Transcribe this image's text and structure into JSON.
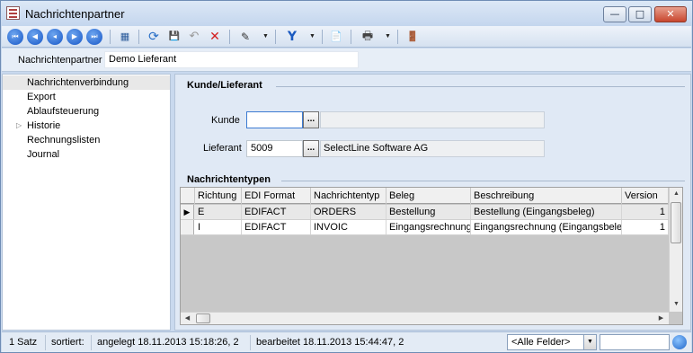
{
  "window": {
    "title": "Nachrichtenpartner"
  },
  "window_controls": {
    "minimize": "—",
    "maximize": "□",
    "close": "✕"
  },
  "toolbar": {
    "icons": [
      "first-record-icon",
      "prev-page-icon",
      "prev-record-icon",
      "next-record-icon",
      "last-record-icon",
      "table-view-icon",
      "refresh-icon",
      "save-icon",
      "undo-icon",
      "delete-icon",
      "tools-icon",
      "filter-icon",
      "document-icon",
      "print-icon",
      "exit-icon"
    ],
    "glyphs": {
      "first": "⏮",
      "prev_page": "◀",
      "prev": "◂",
      "next": "▶",
      "last": "⏭",
      "table": "▦",
      "refresh": "⟳",
      "save": "💾",
      "undo": "↶",
      "delete": "✕",
      "tools": "✎",
      "filter": "Y",
      "document": "📄",
      "print": "🖶",
      "exit": "🚪",
      "dropdown": "▼"
    }
  },
  "partner": {
    "label": "Nachrichtenpartner",
    "value": "Demo Lieferant"
  },
  "sidebar": {
    "items": [
      {
        "label": "Nachrichtenverbindung",
        "active": true,
        "expandable": false
      },
      {
        "label": "Export",
        "active": false,
        "expandable": false
      },
      {
        "label": "Ablaufsteuerung",
        "active": false,
        "expandable": false
      },
      {
        "label": "Historie",
        "active": false,
        "expandable": true
      },
      {
        "label": "Rechnungslisten",
        "active": false,
        "expandable": false
      },
      {
        "label": "Journal",
        "active": false,
        "expandable": false
      }
    ],
    "expander_glyph": "▷"
  },
  "kunde_lieferant": {
    "title": "Kunde/Lieferant",
    "kunde": {
      "label": "Kunde",
      "value": "",
      "lookup": "...",
      "name": ""
    },
    "lieferant": {
      "label": "Lieferant",
      "value": "5009",
      "lookup": "...",
      "name": "SelectLine Software AG"
    }
  },
  "nachrichtentypen": {
    "title": "Nachrichtentypen",
    "columns": [
      "Richtung",
      "EDI Format",
      "Nachrichtentyp",
      "Beleg",
      "Beschreibung",
      "Version"
    ],
    "rows": [
      {
        "indicator": "▶",
        "cells": [
          "E",
          "EDIFACT",
          "ORDERS",
          "Bestellung",
          "Bestellung (Eingangsbeleg)",
          "1"
        ]
      },
      {
        "indicator": "",
        "cells": [
          "I",
          "EDIFACT",
          "INVOIC",
          "Eingangsrechnung",
          "Eingangsrechnung (Eingangsbeleg",
          "1"
        ]
      }
    ]
  },
  "scroll": {
    "up": "▲",
    "down": "▼",
    "left": "◀",
    "right": "▶"
  },
  "status": {
    "count": "1 Satz",
    "sorted": "sortiert:",
    "created": "angelegt 18.11.2013 15:18:26,  2",
    "edited": "bearbeitet 18.11.2013 15:44:47,  2",
    "filter": "<Alle Felder>",
    "filter_arrow": "▼"
  }
}
